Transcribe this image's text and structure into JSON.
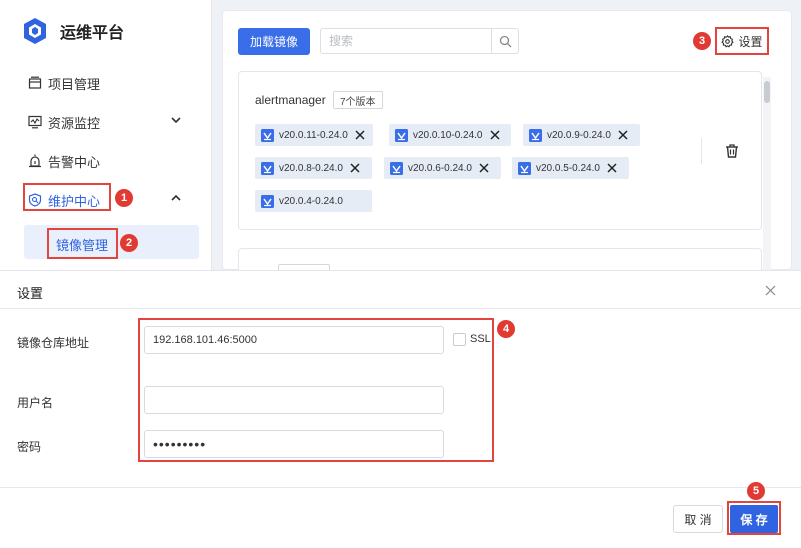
{
  "brand": {
    "name": "运维平台",
    "icon": "cube-logo-icon"
  },
  "sidebar": {
    "items": [
      {
        "label": "项目管理",
        "icon": "project-icon"
      },
      {
        "label": "资源监控",
        "icon": "monitor-icon",
        "expandable": true
      },
      {
        "label": "告警中心",
        "icon": "alarm-icon"
      },
      {
        "label": "维护中心",
        "icon": "maintenance-icon",
        "expandable": true,
        "expanded": true
      }
    ],
    "sub_item": {
      "label": "镜像管理",
      "active": true
    }
  },
  "toolbar": {
    "load_image_label": "加载镜像",
    "search_placeholder": "搜索",
    "settings_label": "设置"
  },
  "image_card": {
    "name": "alertmanager",
    "version_count": "7个版本",
    "tags": [
      "v20.0.11-0.24.0",
      "v20.0.10-0.24.0",
      "v20.0.9-0.24.0",
      "v20.0.8-0.24.0",
      "v20.0.6-0.24.0",
      "v20.0.5-0.24.0",
      "v20.0.4-0.24.0"
    ]
  },
  "dialog": {
    "title": "设置",
    "registry_label": "镜像仓库地址",
    "registry_value": "192.168.101.46:5000",
    "ssl_label": "SSL",
    "ssl_checked": false,
    "username_label": "用户名",
    "username_value": "",
    "password_label": "密码",
    "password_value": "•••••••••",
    "cancel_label": "取 消",
    "save_label": "保 存"
  },
  "annotations": {
    "step1": "1",
    "step2": "2",
    "step3": "3",
    "step4": "4",
    "step5": "5"
  },
  "colors": {
    "primary": "#3a6ee8",
    "active_text": "#2f63e0",
    "annotation_red": "#e03a33",
    "tag_bg": "#e6ecf6"
  }
}
